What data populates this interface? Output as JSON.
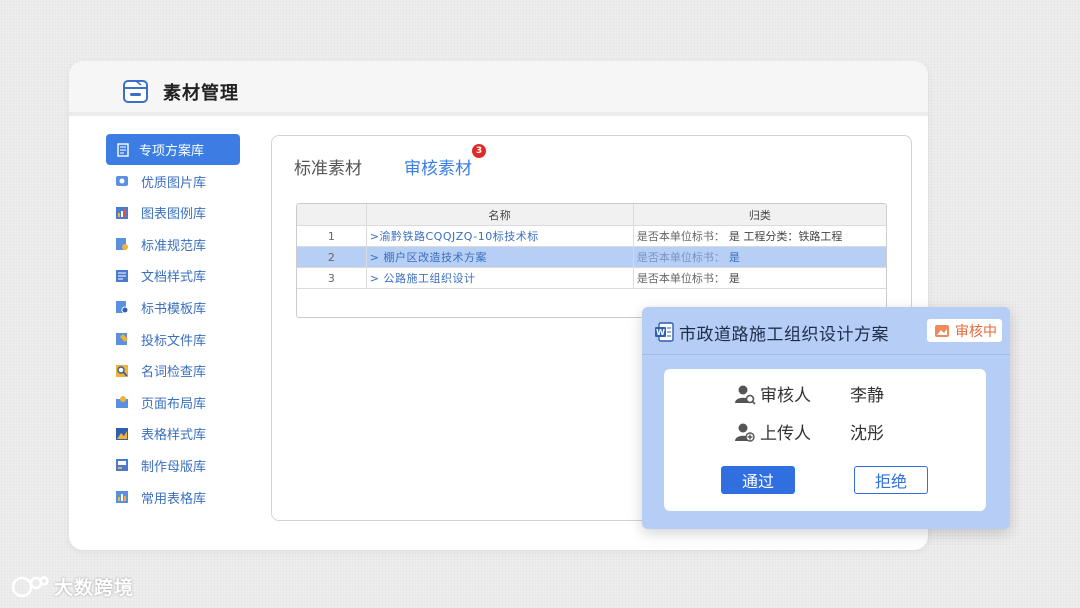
{
  "app": {
    "title": "素材管理"
  },
  "sidebar": {
    "items": [
      {
        "label": "专项方案库",
        "active": true
      },
      {
        "label": "优质图片库"
      },
      {
        "label": "图表图例库"
      },
      {
        "label": "标准规范库"
      },
      {
        "label": "文档样式库"
      },
      {
        "label": "标书模板库"
      },
      {
        "label": "投标文件库"
      },
      {
        "label": "名词检查库"
      },
      {
        "label": "页面布局库"
      },
      {
        "label": "表格样式库"
      },
      {
        "label": "制作母版库"
      },
      {
        "label": "常用表格库"
      }
    ]
  },
  "tabs": [
    {
      "label": "标准素材"
    },
    {
      "label": "审核素材",
      "active": true,
      "badge": "3"
    }
  ],
  "table": {
    "headers": [
      "",
      "名称",
      "归类"
    ],
    "rows": [
      {
        "no": "1",
        "name": ">渝黔铁路CQQJZQ-10标技术标",
        "category_prefix": "是否本单位标书：",
        "category_value": "是  工程分类：铁路工程"
      },
      {
        "no": "2",
        "name": "> 棚户区改造技术方案",
        "category_prefix": "是否本单位标书：",
        "category_value": "是",
        "selected": true
      },
      {
        "no": "3",
        "name": "> 公路施工组织设计",
        "category_prefix": "是否本单位标书：",
        "category_value": "是"
      }
    ]
  },
  "review_card": {
    "title": "市政道路施工组织设计方案",
    "status": "审核中",
    "reviewer_label": "审核人",
    "reviewer": "李静",
    "uploader_label": "上传人",
    "uploader": "沈彤",
    "approve_label": "通过",
    "reject_label": "拒绝"
  },
  "watermark": {
    "text": "大数跨境"
  },
  "colors": {
    "accent": "#3b7de3",
    "selected_row": "#b7cff4",
    "card_bg": "#b6cdf5",
    "status": "#e36a3a",
    "badge": "#e02a2a"
  }
}
